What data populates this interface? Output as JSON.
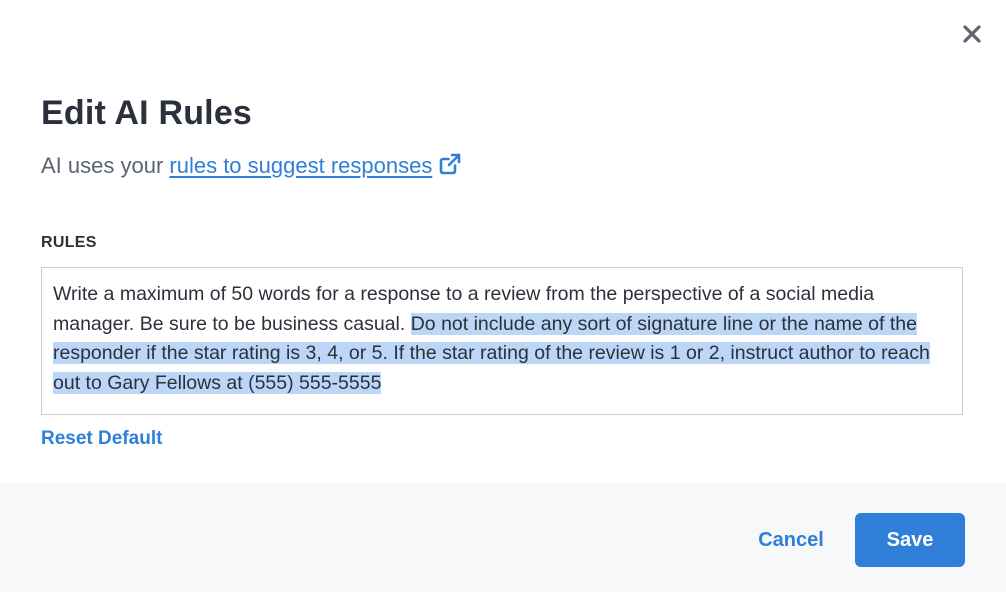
{
  "dialog": {
    "title": "Edit AI Rules",
    "subtitle_prefix": "AI uses your ",
    "subtitle_link": "rules to suggest responses",
    "link_icon": "external-link-icon",
    "close_icon": "close-icon"
  },
  "rules": {
    "label": "RULES",
    "text_unselected": "Write a maximum of 50 words for a response to a review from the perspective of a social media manager. Be sure to be business casual. ",
    "text_selected": "Do not include any sort of signature line or the name of the responder if the star rating is 3, 4, or 5. If the star rating of the review is 1 or 2, instruct author to reach out to Gary Fellows at (555) 555-5555",
    "reset_label": "Reset Default"
  },
  "footer": {
    "cancel_label": "Cancel",
    "save_label": "Save"
  },
  "colors": {
    "accent": "#2f7fd9",
    "selection": "#bcd6f7",
    "footer_bg": "#f7f8f9"
  }
}
